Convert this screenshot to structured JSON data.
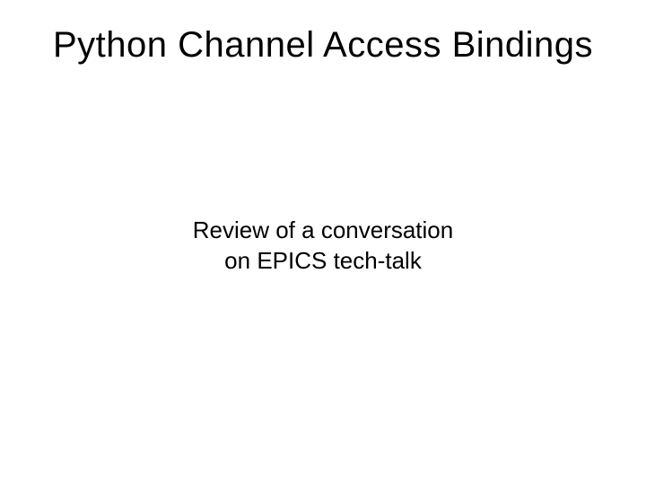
{
  "slide": {
    "title": "Python Channel Access Bindings",
    "subtitle_line1": "Review of a conversation",
    "subtitle_line2": "on EPICS tech-talk"
  }
}
